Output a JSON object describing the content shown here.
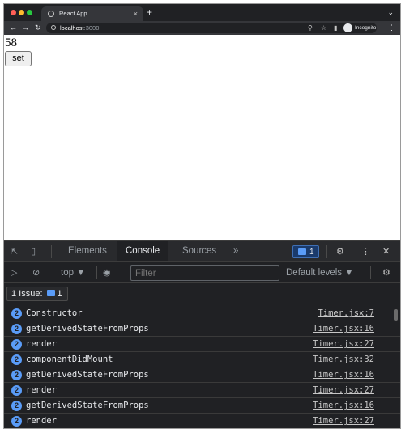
{
  "browser": {
    "tab_title": "React App",
    "tab_close": "×",
    "new_tab": "+",
    "chevron": "⌄",
    "url_host": "localhost",
    "url_port": ":3000",
    "profile_label": "Incognito",
    "icons": [
      "back-arrow-icon",
      "forward-arrow-icon",
      "reload-icon",
      "zoom-icon",
      "star-icon",
      "sidepanel-icon"
    ]
  },
  "page": {
    "counter": "58",
    "set_button": "set"
  },
  "devtools": {
    "tabs": {
      "elements": "Elements",
      "console": "Console",
      "sources": "Sources",
      "more": "»"
    },
    "issues_badge_count": "1",
    "context": "top ▼",
    "filter_placeholder": "Filter",
    "levels": "Default levels ▼",
    "issues_label": "1 Issue:",
    "issues_count": "1",
    "logs": [
      {
        "count": "2",
        "message": "Constructor",
        "source": "Timer.jsx:7"
      },
      {
        "count": "2",
        "message": "getDerivedStateFromProps",
        "source": "Timer.jsx:16"
      },
      {
        "count": "2",
        "message": "render",
        "source": "Timer.jsx:27"
      },
      {
        "count": "2",
        "message": "componentDidMount",
        "source": "Timer.jsx:32"
      },
      {
        "count": "2",
        "message": "getDerivedStateFromProps",
        "source": "Timer.jsx:16"
      },
      {
        "count": "2",
        "message": "render",
        "source": "Timer.jsx:27"
      },
      {
        "count": "2",
        "message": "getDerivedStateFromProps",
        "source": "Timer.jsx:16"
      },
      {
        "count": "2",
        "message": "render",
        "source": "Timer.jsx:27"
      }
    ],
    "colors": {
      "accent": "#5a9cf8",
      "background": "#202124",
      "text": "#e8eaed"
    }
  }
}
